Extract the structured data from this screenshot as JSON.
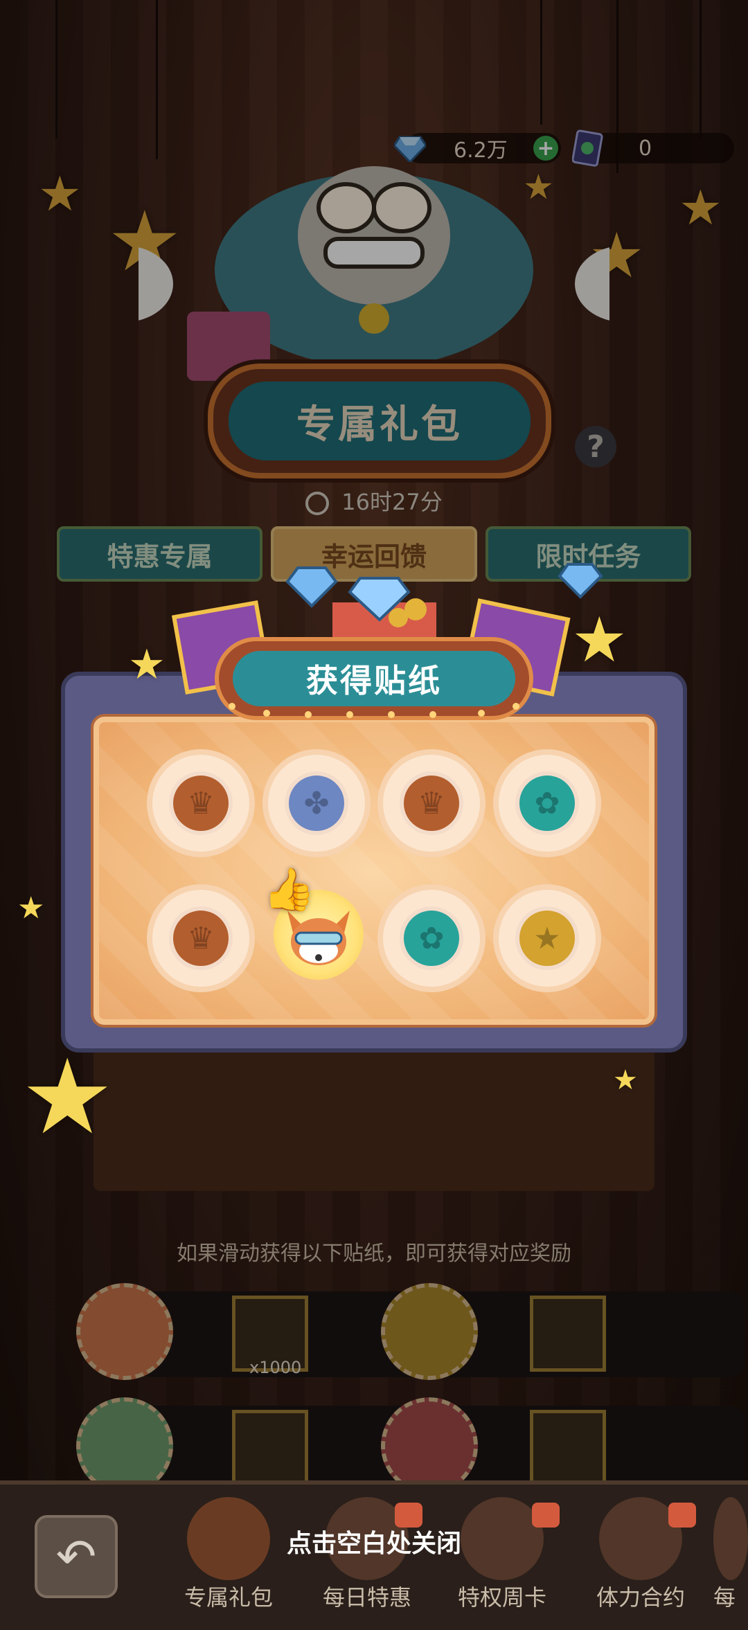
{
  "currency": {
    "gems": "6.2万",
    "tickets": "0"
  },
  "page": {
    "title": "专属礼包",
    "timer": "16时27分",
    "help_glyph": "?"
  },
  "tabs": [
    {
      "label": "特惠专属"
    },
    {
      "label": "幸运回馈"
    },
    {
      "label": "限时任务"
    }
  ],
  "popup": {
    "title": "获得贴纸",
    "stickers_row1": [
      "brown",
      "blue",
      "brown",
      "teal"
    ],
    "stickers_row2": [
      "brown",
      "fox",
      "teal",
      "gold"
    ]
  },
  "rewards": {
    "hint": "如果滑动获得以下贴纸，即可获得对应奖励",
    "row1_qty": "x1000"
  },
  "close_hint": "点击空白处关闭",
  "nav": [
    {
      "label": "专属礼包"
    },
    {
      "label": "每日特惠"
    },
    {
      "label": "特权周卡"
    },
    {
      "label": "体力合约"
    },
    {
      "label": "每"
    }
  ],
  "colors": {
    "accent_teal": "#2b8e96",
    "board_orange": "#f0b476",
    "frame_purple": "#5a5a85"
  }
}
